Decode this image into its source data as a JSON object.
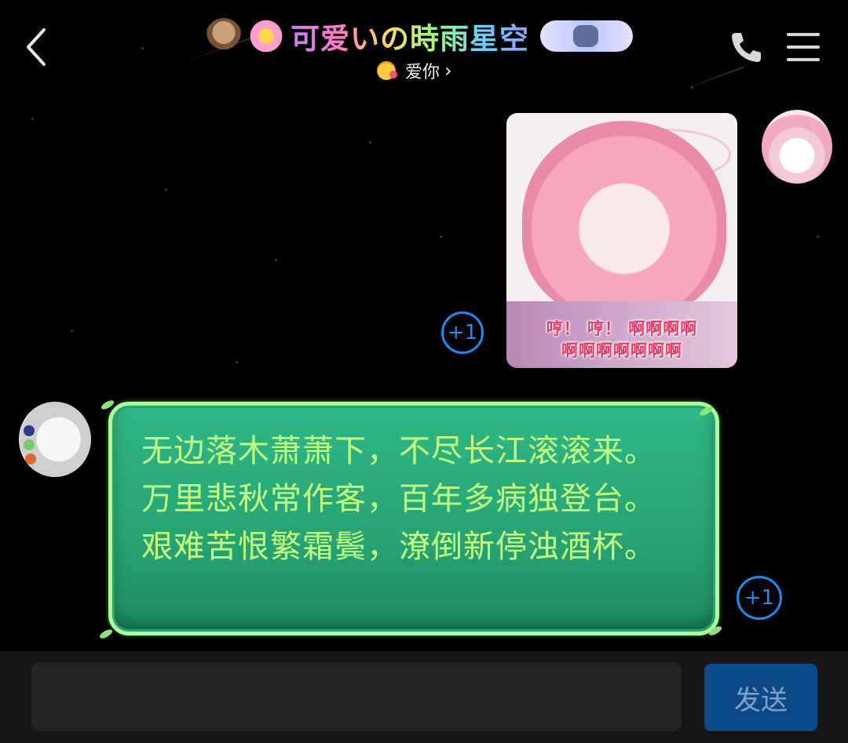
{
  "header": {
    "title": "可爱いの時雨星空",
    "subtitle": "爱你",
    "subtitle_chevron": "›",
    "back_icon": "chevron-left-icon",
    "call_icon": "phone-icon",
    "menu_icon": "hamburger-menu-icon"
  },
  "messages": [
    {
      "sender": "me",
      "type": "sticker",
      "caption_line1": "哼！ 哼！ 啊啊啊啊",
      "caption_line2": "啊啊啊啊啊啊啊",
      "plus_one": "+1"
    },
    {
      "sender": "other",
      "type": "text",
      "text": "无边落木萧萧下，不尽长江滚滚来。万里悲秋常作客，百年多病独登台。艰难苦恨繁霜鬓，潦倒新停浊酒杯。",
      "plus_one": "+1"
    }
  ],
  "composer": {
    "input_value": "",
    "send_label": "发送"
  },
  "colors": {
    "accent_blue": "#1e8df0",
    "bubble_green": "#2fb787",
    "bubble_text": "#c3ff7e",
    "send_button": "#0b4a86"
  }
}
